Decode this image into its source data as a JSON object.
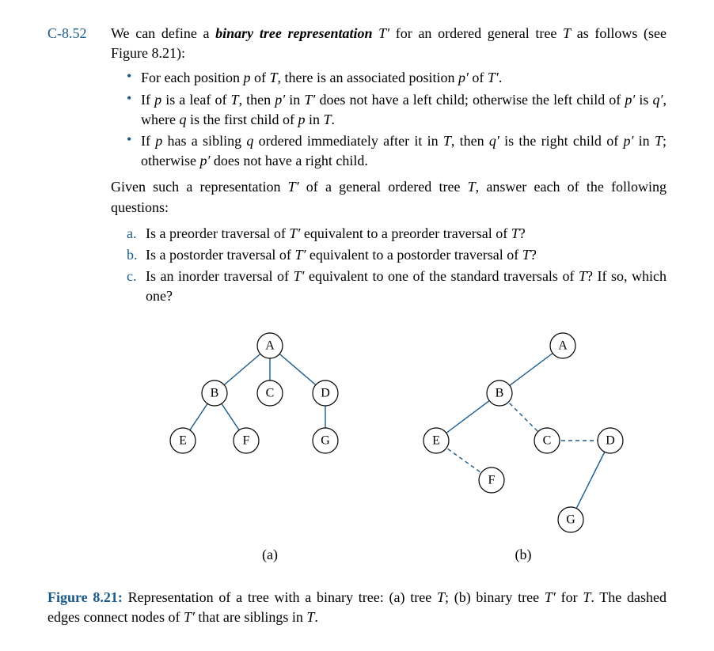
{
  "problem_number": "C-8.52",
  "intro_part1": "We can define a ",
  "intro_bold": "binary tree representation",
  "intro_part2": " T′ for an ordered general tree T as follows (see Figure 8.21):",
  "bullets": [
    "For each position p of T, there is an associated position p′ of T′.",
    "If p is a leaf of T, then p′ in T′ does not have a left child; otherwise the left child of p′ is q′, where q is the first child of p in T.",
    "If p has a sibling q ordered immediately after it in T, then q′ is the right child of p′ in T; otherwise p′ does not have a right child."
  ],
  "given": "Given such a representation T′ of a general ordered tree T, answer each of the following questions:",
  "questions": {
    "a": "Is a preorder traversal of T′ equivalent to a preorder traversal of T?",
    "b": "Is a postorder traversal of T′ equivalent to a postorder traversal of T?",
    "c": "Is an inorder traversal of T′ equivalent to one of the standard traversals of T? If so, which one?"
  },
  "labels": {
    "a": "a.",
    "b": "b.",
    "c": "c."
  },
  "nodes": {
    "A": "A",
    "B": "B",
    "C": "C",
    "D": "D",
    "E": "E",
    "F": "F",
    "G": "G"
  },
  "sublabels": {
    "a": "(a)",
    "b": "(b)"
  },
  "figure": {
    "label": "Figure 8.21:",
    "caption": " Representation of a tree with a binary tree: (a) tree T; (b) binary tree T′ for T. The dashed edges connect nodes of T′ that are siblings in T."
  }
}
